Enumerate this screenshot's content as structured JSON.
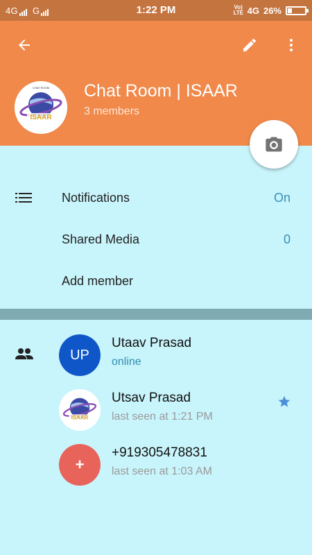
{
  "status_bar": {
    "network_left": "4G",
    "network_left2": "G",
    "time": "1:22 PM",
    "volte": "Vo) LTE",
    "network_right": "4G",
    "battery": "26%"
  },
  "header": {
    "title": "Chat Room | ISAAR",
    "subtitle": "3 members",
    "avatar_text": "ISAAR",
    "avatar_small": "CHAT ROOM"
  },
  "settings": [
    {
      "label": "Notifications",
      "value": "On"
    },
    {
      "label": "Shared Media",
      "value": "0"
    },
    {
      "label": "Add member"
    }
  ],
  "members": [
    {
      "name": "Utaav Prasad",
      "status": "online",
      "initials": "UP",
      "avatar_color": "#0f56c9"
    },
    {
      "name": "Utsav Prasad",
      "status": "last seen at 1:21 PM",
      "avatar_text": "ISAAR",
      "starred": true
    },
    {
      "name": "+919305478831",
      "status": "last seen at 1:03 AM",
      "initials": "+",
      "avatar_color": "#e8645a"
    }
  ],
  "colors": {
    "header": "#f0894a",
    "status_bar": "#c4743f",
    "background": "#c8f4fb",
    "divider": "#80aab1",
    "accent_blue": "#3a8fb5",
    "star": "#4a90d9"
  },
  "icons": {
    "back": "arrow-left",
    "edit": "pencil",
    "more": "dots-vertical",
    "camera": "camera",
    "list": "list",
    "members": "people",
    "star": "star"
  }
}
